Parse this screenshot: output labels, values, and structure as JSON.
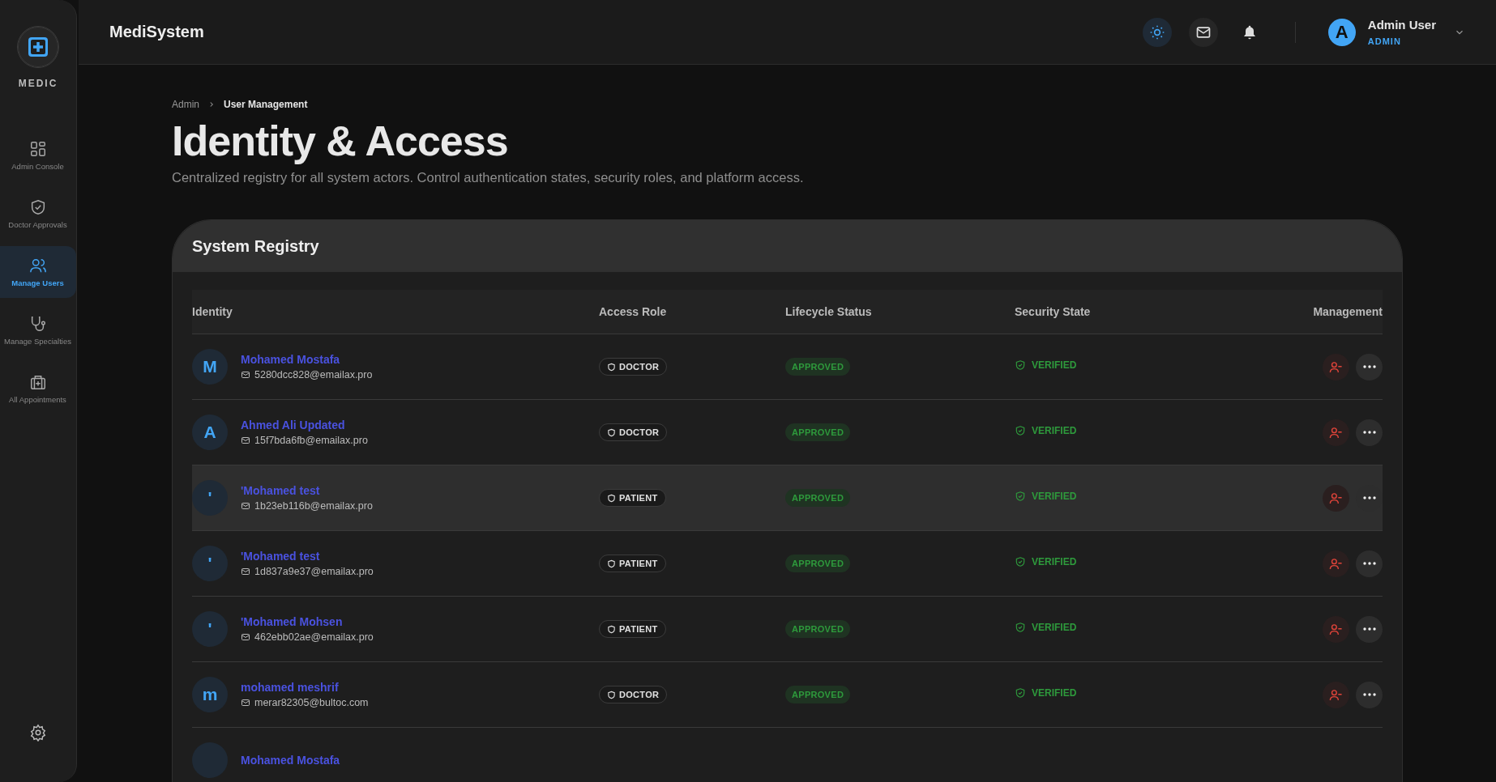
{
  "brand": {
    "name": "MEDIC"
  },
  "sidebar": {
    "items": [
      {
        "label": "Admin Console",
        "kind": "grid",
        "selected": false
      },
      {
        "label": "Doctor Approvals",
        "kind": "shield",
        "selected": false
      },
      {
        "label": "Manage Users",
        "kind": "users",
        "selected": true
      },
      {
        "label": "Manage Specialties",
        "kind": "stethoscope",
        "selected": false
      },
      {
        "label": "All Appointments",
        "kind": "medkit",
        "selected": false
      }
    ]
  },
  "header": {
    "title": "MediSystem",
    "user": {
      "initial": "A",
      "name": "Admin User",
      "role": "ADMIN"
    }
  },
  "breadcrumb": [
    "Admin",
    "User Management"
  ],
  "page": {
    "title": "Identity & Access",
    "subtitle": "Centralized registry for all system actors. Control authentication states, security roles, and platform access."
  },
  "registry": {
    "title": "System Registry",
    "columns": [
      "Identity",
      "Access Role",
      "Lifecycle Status",
      "Security State",
      "Management"
    ],
    "rows": [
      {
        "initial": "M",
        "name": "Mohamed Mostafa",
        "email": "5280dcc828@emailax.pro",
        "role": "DOCTOR",
        "status": "APPROVED",
        "security": "VERIFIED",
        "hovered": false
      },
      {
        "initial": "A",
        "name": "Ahmed Ali Updated",
        "email": "15f7bda6fb@emailax.pro",
        "role": "DOCTOR",
        "status": "APPROVED",
        "security": "VERIFIED",
        "hovered": false
      },
      {
        "initial": "'",
        "name": "'Mohamed test",
        "email": "1b23eb116b@emailax.pro",
        "role": "PATIENT",
        "status": "APPROVED",
        "security": "VERIFIED",
        "hovered": true
      },
      {
        "initial": "'",
        "name": "'Mohamed test",
        "email": "1d837a9e37@emailax.pro",
        "role": "PATIENT",
        "status": "APPROVED",
        "security": "VERIFIED",
        "hovered": false
      },
      {
        "initial": "'",
        "name": "'Mohamed Mohsen",
        "email": "462ebb02ae@emailax.pro",
        "role": "PATIENT",
        "status": "APPROVED",
        "security": "VERIFIED",
        "hovered": false
      },
      {
        "initial": "m",
        "name": "mohamed meshrif",
        "email": "merar82305@bultoc.com",
        "role": "DOCTOR",
        "status": "APPROVED",
        "security": "VERIFIED",
        "hovered": false
      },
      {
        "name": "Mohamed Mostafa",
        "hovered": false
      }
    ]
  }
}
